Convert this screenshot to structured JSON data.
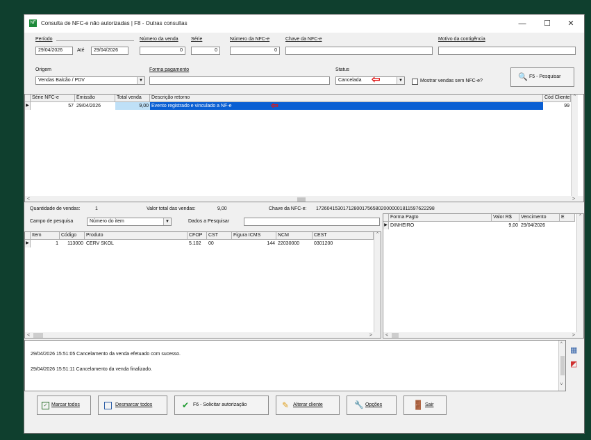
{
  "window": {
    "title": "Consulta de NFC-e não autorizadas | F8 - Outras consultas",
    "app_icon_text": "NF",
    "minimize_symbol": "—",
    "maximize_symbol": "☐",
    "close_symbol": "✕"
  },
  "filters": {
    "periodo_label": "Período",
    "date_from": "29/04/2026",
    "ate_label": "Até",
    "date_to": "29/04/2026",
    "numero_venda_label": "Número da venda",
    "numero_venda": "0",
    "serie_label": "Série",
    "serie": "0",
    "numero_nfce_label": "Número da NFC-e",
    "numero_nfce": "0",
    "chave_nfce_label": "Chave da NFC-e",
    "chave_nfce": "",
    "motivo_label": "Motivo da contigência",
    "motivo": "",
    "origem_label": "Origem",
    "origem": "Vendas Balcão / PDV",
    "forma_pagamento_label": "Forma pagamento",
    "forma_pagamento": "",
    "status_label": "Status",
    "status": "Cancelada",
    "mostrar_label": "Mostrar vendas sem NFC-e?",
    "pesquisar_label": "F5 - Pesquisar"
  },
  "sales_grid": {
    "headers": [
      "Série NFC-e",
      "Emissão",
      "Total venda",
      "Descrição retorno",
      "Cód Cliente"
    ],
    "rows": [
      {
        "serie": "57",
        "emissao": "29/04/2026",
        "total": "9,00",
        "descricao": "Evento registrado e vinculado a NF-e",
        "cod_cliente": "99"
      }
    ]
  },
  "summary": {
    "quantidade_label": "Quantidade de vendas:",
    "quantidade": "1",
    "valor_total_label": "Valor total das vendas:",
    "valor_total": "9,00",
    "chave_label": "Chave da NFC-e:",
    "chave": "17260415301712800175658020000001811597622298"
  },
  "item_search": {
    "campo_label": "Campo de pesquisa",
    "campo_value": "Número do item",
    "dados_label": "Dados a Pesquisar",
    "dados_value": ""
  },
  "items_grid": {
    "headers": [
      "Item",
      "Código",
      "Produto",
      "CFOP",
      "CST",
      "Figura ICMS",
      "NCM",
      "CEST"
    ],
    "rows": [
      {
        "item": "1",
        "codigo": "113000",
        "produto": "CERV SKOL",
        "cfop": "5.102",
        "cst": "00",
        "figura": "144",
        "ncm": "22030000",
        "cest": "0301200"
      }
    ]
  },
  "payments_grid": {
    "headers": [
      "Forma Pagto",
      "Valor R$",
      "Vencimento",
      "E"
    ],
    "rows": [
      {
        "forma": "DINHEIRO",
        "valor": "9,00",
        "vencimento": "29/04/2026"
      }
    ]
  },
  "log": {
    "lines": [
      "29/04/2026 15:51:05 Cancelamento da venda efetuado com sucesso.",
      "29/04/2026 15:51:11 Cancelamento da venda finalizado."
    ]
  },
  "buttons": {
    "marcar": "Marcar todos",
    "desmarcar": "Desmarcar todos",
    "solicitar": "F6 - Solicitar autorização",
    "alterar": "Alterar cliente",
    "opcoes": "Opções",
    "sair": "Sair"
  },
  "colors": {
    "background": "#0f3f2e",
    "selection": "#0a5fd3",
    "accent_red": "#e01818"
  }
}
